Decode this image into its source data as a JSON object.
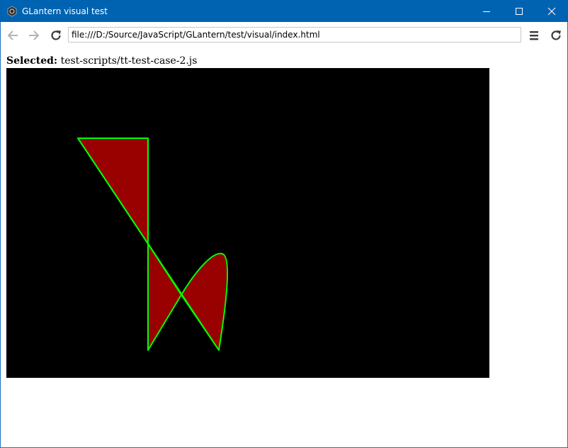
{
  "window": {
    "title": "GLantern visual test",
    "controls": [
      "minimize",
      "maximize",
      "close"
    ]
  },
  "toolbar": {
    "back_icon": "arrow-left-icon",
    "forward_icon": "arrow-right-icon",
    "reload_icon": "refresh-icon",
    "address": "file:///D:/Source/JavaScript/GLantern/test/visual/index.html",
    "menu_icon": "hamburger-icon",
    "reload_right_icon": "refresh-icon"
  },
  "page": {
    "selected_label": "Selected:",
    "selected_value": "test-scripts/tt-test-case-2.js"
  },
  "canvas": {
    "background": "#000000",
    "fill_color": "#990000",
    "stroke_color": "#00ff00"
  },
  "colors": {
    "titlebar": "#0063b1",
    "nav_disabled": "#b4b4b4",
    "nav_enabled": "#3c3c3c"
  }
}
